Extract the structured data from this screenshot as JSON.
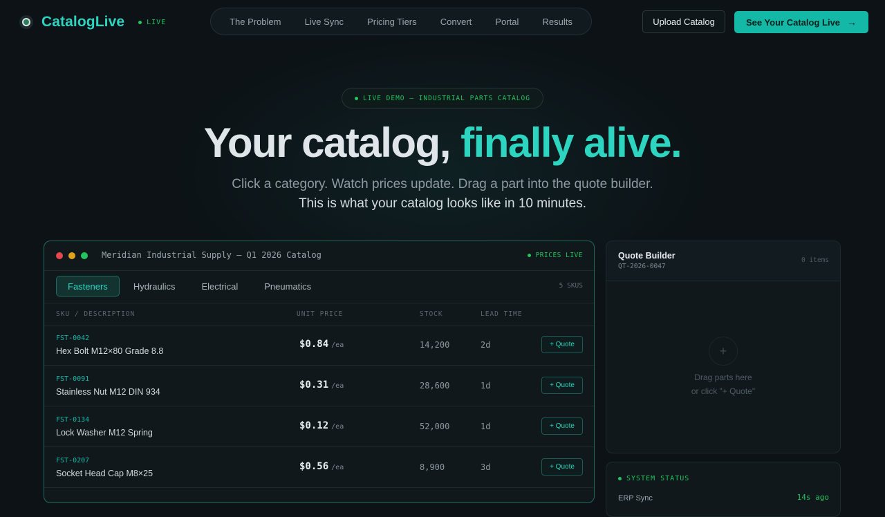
{
  "nav": {
    "brand": "CatalogLive",
    "live": "LIVE",
    "links": [
      "The Problem",
      "Live Sync",
      "Pricing Tiers",
      "Convert",
      "Portal",
      "Results"
    ],
    "upload": "Upload Catalog",
    "cta": "See Your Catalog Live",
    "cta_arrow": "→"
  },
  "hero": {
    "pill": "LIVE DEMO — INDUSTRIAL PARTS CATALOG",
    "headline_main": "Your catalog, ",
    "headline_accent": "finally alive.",
    "sub1": "Click a category. Watch prices update. Drag a part into the quote builder.",
    "sub2": "This is what your catalog looks like in 10 minutes."
  },
  "catalog": {
    "title": "Meridian Industrial Supply — Q1 2026 Catalog",
    "status": "PRICES LIVE",
    "tabs": [
      "Fasteners",
      "Hydraulics",
      "Electrical",
      "Pneumatics"
    ],
    "active_tab": "Fasteners",
    "sku_count": "5 SKUS",
    "columns": [
      "SKU / DESCRIPTION",
      "UNIT PRICE",
      "STOCK",
      "LEAD TIME"
    ],
    "rows": [
      {
        "sku": "FST-0042",
        "desc": "Hex Bolt M12×80 Grade 8.8",
        "price": "$0.84",
        "unit": "/ea",
        "stock": "14,200",
        "lead": "2d",
        "action": "+ Quote"
      },
      {
        "sku": "FST-0091",
        "desc": "Stainless Nut M12 DIN 934",
        "price": "$0.31",
        "unit": "/ea",
        "stock": "28,600",
        "lead": "1d",
        "action": "+ Quote"
      },
      {
        "sku": "FST-0134",
        "desc": "Lock Washer M12 Spring",
        "price": "$0.12",
        "unit": "/ea",
        "stock": "52,000",
        "lead": "1d",
        "action": "+ Quote"
      },
      {
        "sku": "FST-0207",
        "desc": "Socket Head Cap M8×25",
        "price": "$0.56",
        "unit": "/ea",
        "stock": "8,900",
        "lead": "3d",
        "action": "+ Quote"
      }
    ]
  },
  "quote": {
    "title": "Quote Builder",
    "id": "QT-2026-0047",
    "items": "0 items",
    "plus": "+",
    "hint1": "Drag parts here",
    "hint2": "or click \"+ Quote\""
  },
  "status": {
    "title": "SYSTEM STATUS",
    "label": "ERP Sync",
    "value": "14s ago"
  },
  "colors": {
    "background": "#0c1216",
    "accent": "#2dd4bf",
    "primary_button": "#14b8a6",
    "live_green": "#22c55e"
  },
  "icons": {
    "brand": "brand-logo-icon",
    "live": "live-dot-icon",
    "cta": "arrow-right-icon",
    "window": "window-controls-icon",
    "quote_empty": "plus-icon"
  }
}
